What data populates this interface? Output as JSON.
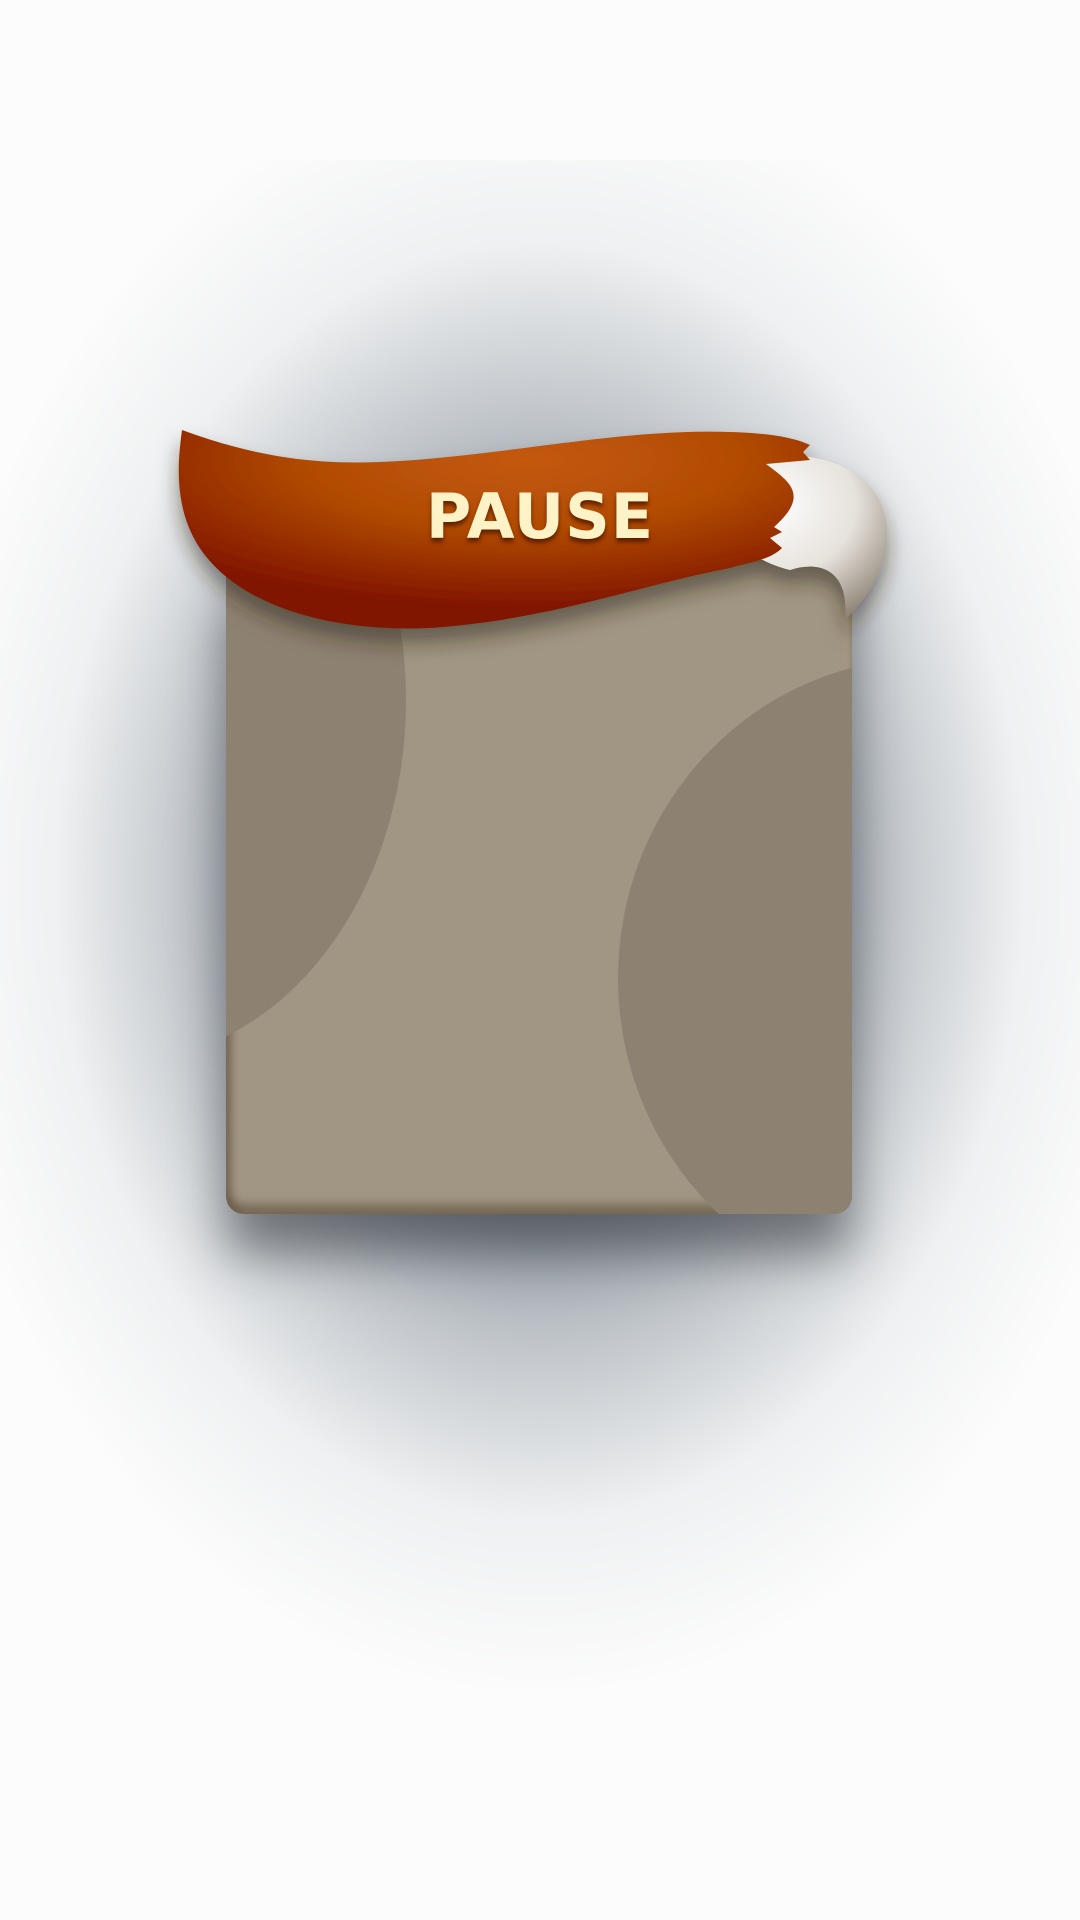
{
  "pause_menu": {
    "title": "PAUSE"
  },
  "colors": {
    "panel": "#a19683",
    "panel_blob": "#8d8171",
    "tail_orange": "#b24c06",
    "tail_dark": "#801400",
    "tail_tip_white": "#f4f2ee",
    "title_text": "#fdf3c6",
    "overlay": "#4e5a66"
  },
  "icons": {
    "banner": "fox-tail-icon"
  }
}
